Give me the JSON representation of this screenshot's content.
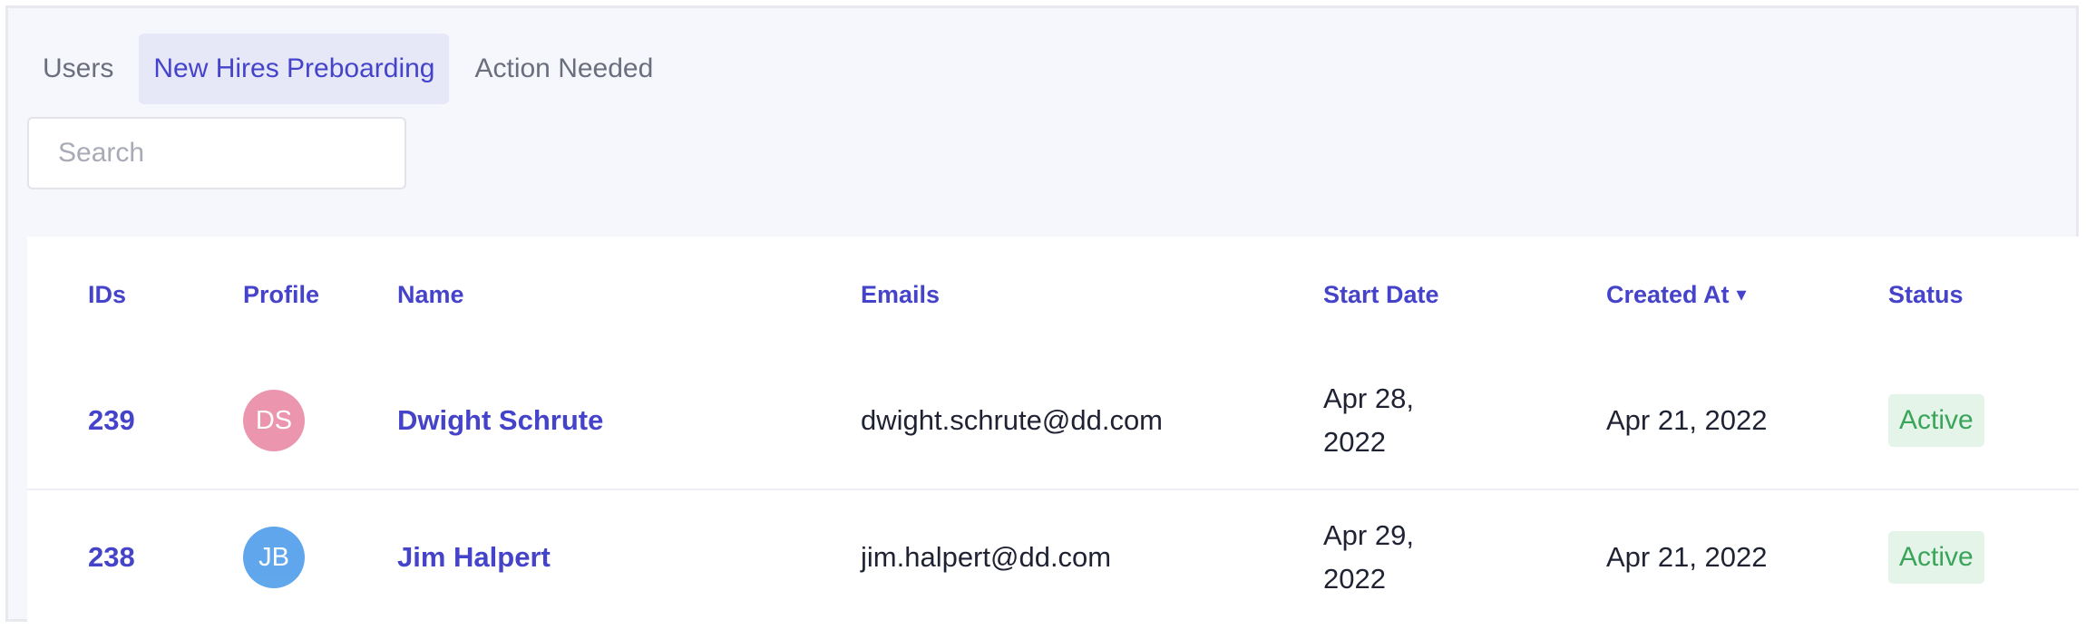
{
  "tabs": [
    {
      "label": "Users",
      "active": false
    },
    {
      "label": "New Hires Preboarding",
      "active": true
    },
    {
      "label": "Action Needed",
      "active": false
    }
  ],
  "search": {
    "placeholder": "Search",
    "value": ""
  },
  "table": {
    "columns": {
      "ids": "IDs",
      "profile": "Profile",
      "name": "Name",
      "emails": "Emails",
      "start_date": "Start Date",
      "created_at": "Created At",
      "status": "Status"
    },
    "sort_indicator": "▾",
    "sort_column": "created_at",
    "rows": [
      {
        "id": "239",
        "initials": "DS",
        "avatar_color": "#e98aa6",
        "name": "Dwight Schrute",
        "email": "dwight.schrute@dd.com",
        "start_date": "Apr 28, 2022",
        "created_at": "Apr 21, 2022",
        "status": "Active"
      },
      {
        "id": "238",
        "initials": "JB",
        "avatar_color": "#4f9dea",
        "name": "Jim Halpert",
        "email": "jim.halpert@dd.com",
        "start_date": "Apr 29, 2022",
        "created_at": "Apr 21, 2022",
        "status": "Active"
      }
    ]
  },
  "colors": {
    "accent": "#4543c9",
    "status_active_bg": "#e4f4e8",
    "status_active_text": "#3aa45a",
    "page_bg": "#f6f7fc"
  }
}
